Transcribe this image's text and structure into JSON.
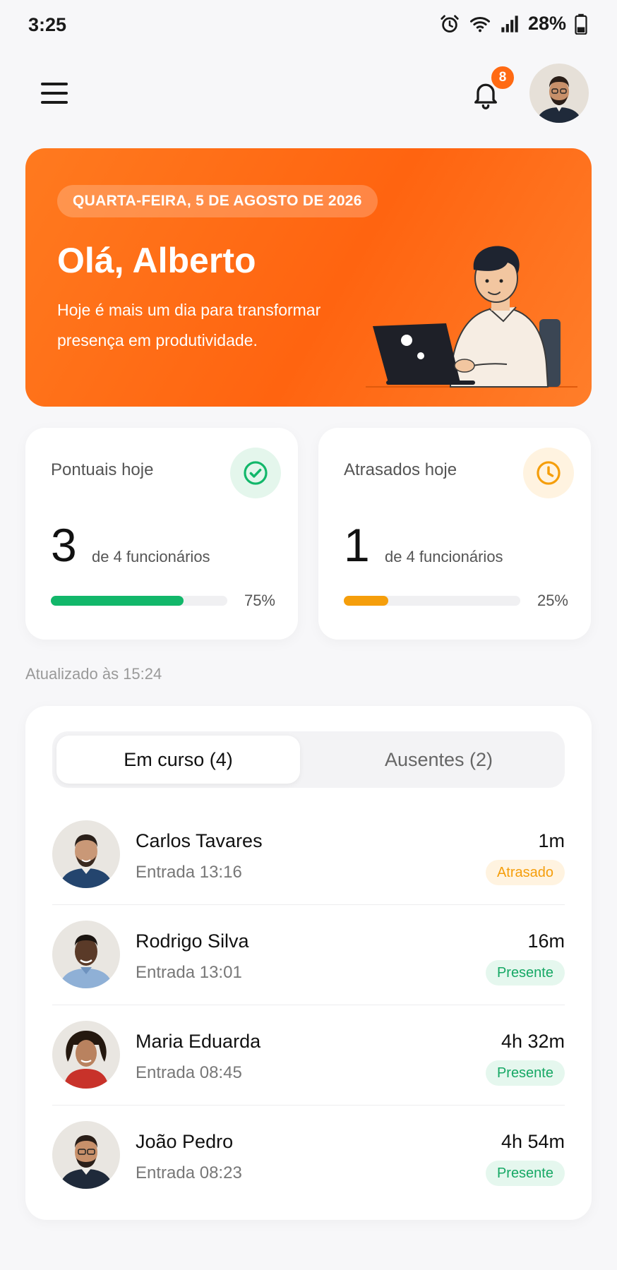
{
  "status_bar": {
    "time": "3:25",
    "battery": "28%"
  },
  "header": {
    "notification_count": "8",
    "icons": [
      "menu-icon",
      "bell-icon",
      "profile-avatar"
    ]
  },
  "hero": {
    "date": "QUARTA-FEIRA, 5 DE AGOSTO DE 2026",
    "greeting": "Olá, Alberto",
    "message": "Hoje é mais um dia para transformar presença em produtividade.",
    "background": "#FF6A13"
  },
  "stats": {
    "punctual": {
      "label": "Pontuais hoje",
      "count": "3",
      "sub": "de 4 funcionários",
      "percent_text": "75%",
      "progress": 0.75,
      "color": "#12B76A"
    },
    "late": {
      "label": "Atrasados hoje",
      "count": "1",
      "sub": "de 4 funcionários",
      "percent_text": "25%",
      "progress": 0.25,
      "color": "#F59E0B"
    }
  },
  "updated": "Atualizado às 15:24",
  "tabs": {
    "active": "Em curso (4)",
    "inactive": "Ausentes (2)"
  },
  "employees": [
    {
      "name": "Carlos Tavares",
      "entry": "Entrada 13:16",
      "duration": "1m",
      "status": "Atrasado",
      "status_type": "late"
    },
    {
      "name": "Rodrigo Silva",
      "entry": "Entrada 13:01",
      "duration": "16m",
      "status": "Presente",
      "status_type": "present"
    },
    {
      "name": "Maria Eduarda",
      "entry": "Entrada 08:45",
      "duration": "4h 32m",
      "status": "Presente",
      "status_type": "present"
    },
    {
      "name": "João Pedro",
      "entry": "Entrada 08:23",
      "duration": "4h 54m",
      "status": "Presente",
      "status_type": "present"
    }
  ]
}
